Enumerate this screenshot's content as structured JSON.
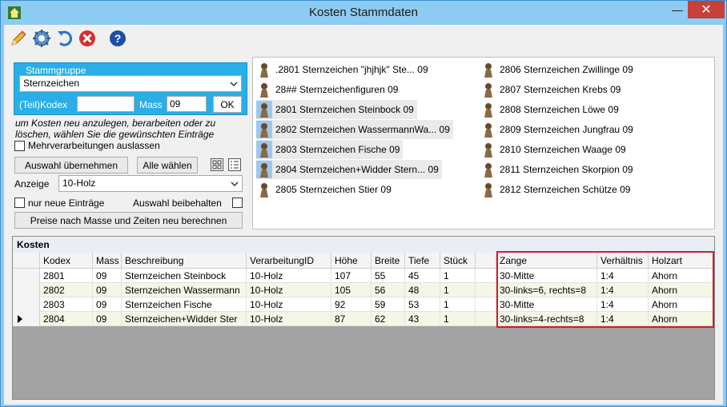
{
  "window": {
    "title": "Kosten Stammdaten",
    "min_label": "—",
    "close_label": "✕"
  },
  "toolbar": {
    "icons": [
      "pencil-icon",
      "gear-icon",
      "undo-icon",
      "cancel-icon",
      "help-icon"
    ]
  },
  "stammgruppe": {
    "legend": "Stammgruppe",
    "selected": "Sternzeichen",
    "kodex_label": "(Teil)Kodex",
    "kodex_value": "",
    "mass_label": "Mass",
    "mass_value": "09",
    "ok_label": "OK"
  },
  "left": {
    "hint": "um Kosten neu anzulegen, berarbeiten oder zu löschen, wählen Sie die gewünschten Einträge",
    "mehr_label": "Mehrverarbeitungen auslassen",
    "btn_uebernehmen": "Auswahl übernehmen",
    "btn_alle": "Alle wählen",
    "anzeige_label": "Anzeige",
    "anzeige_value": "10-Holz",
    "neue_label": "nur neue Einträge",
    "beibehalten_label": "Auswahl beibehalten",
    "btn_preise": "Preise nach Masse und Zeiten neu berechnen"
  },
  "list": {
    "col1": [
      {
        "text": ".2801 Sternzeichen \"jhjhjk\" Ste... 09",
        "selected": false
      },
      {
        "text": "28## Sternzeichenfiguren 09",
        "selected": false
      },
      {
        "text": "2801 Sternzeichen Steinbock 09",
        "selected": true
      },
      {
        "text": "2802 Sternzeichen WassermannWa... 09",
        "selected": true
      },
      {
        "text": "2803 Sternzeichen Fische 09",
        "selected": true
      },
      {
        "text": "2804 Sternzeichen+Widder Stern... 09",
        "selected": true
      },
      {
        "text": "2805 Sternzeichen Stier 09",
        "selected": false
      }
    ],
    "col2": [
      {
        "text": "2806 Sternzeichen Zwillinge 09"
      },
      {
        "text": "2807 Sternzeichen Krebs 09"
      },
      {
        "text": "2808 Sternzeichen Löwe 09"
      },
      {
        "text": "2809 Sternzeichen Jungfrau 09"
      },
      {
        "text": "2810 Sternzeichen Waage 09"
      },
      {
        "text": "2811 Sternzeichen Skorpion 09"
      },
      {
        "text": "2812 Sternzeichen Schütze 09"
      }
    ]
  },
  "kosten": {
    "header": "Kosten",
    "columns": [
      "Kodex",
      "Mass",
      "Beschreibung",
      "VerarbeitungID",
      "Höhe",
      "Breite",
      "Tiefe",
      "Stück",
      "",
      "Zange",
      "Verhältnis",
      "Holzart"
    ],
    "rows": [
      [
        "2801",
        "09",
        "Sternzeichen Steinbock",
        "10-Holz",
        "107",
        "55",
        "45",
        "1",
        "",
        "30-Mitte",
        "1:4",
        "Ahorn"
      ],
      [
        "2802",
        "09",
        "Sternzeichen Wassermann",
        "10-Holz",
        "105",
        "56",
        "48",
        "1",
        "",
        "30-links=6, rechts=8",
        "1:4",
        "Ahorn"
      ],
      [
        "2803",
        "09",
        "Sternzeichen Fische",
        "10-Holz",
        "92",
        "59",
        "53",
        "1",
        "",
        "30-Mitte",
        "1:4",
        "Ahorn"
      ],
      [
        "2804",
        "09",
        "Sternzeichen+Widder Ster",
        "10-Holz",
        "87",
        "62",
        "43",
        "1",
        "",
        "30-links=4-rechts=8",
        "1:4",
        "Ahorn"
      ]
    ],
    "current_row": 3
  },
  "colors": {
    "groupbox": "#29aee8",
    "window_frame": "#8ccbf2",
    "highlight": "#d11c2b"
  }
}
